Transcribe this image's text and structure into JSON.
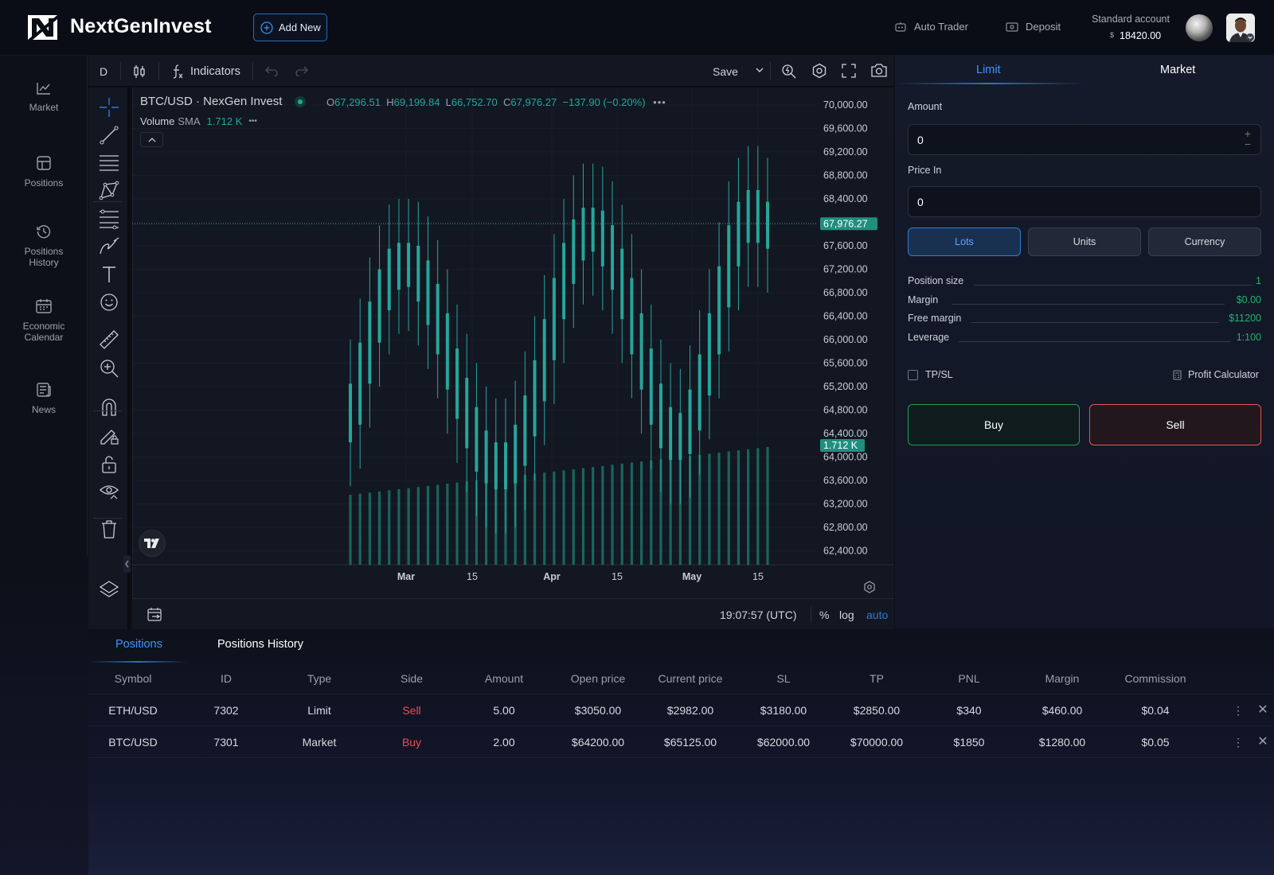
{
  "header": {
    "brand": "NextGenInvest",
    "add_new": "Add New",
    "auto_trader": "Auto Trader",
    "deposit": "Deposit",
    "account_label": "Standard account",
    "account_currency": "$",
    "account_balance": "18420.00"
  },
  "sidebar": {
    "items": [
      {
        "label": "Market",
        "icon": "chart-line-icon"
      },
      {
        "label": "Positions",
        "icon": "positions-icon"
      },
      {
        "label": "Positions History",
        "icon": "history-icon"
      },
      {
        "label": "Economic Calendar",
        "icon": "calendar-icon"
      },
      {
        "label": "News",
        "icon": "news-icon"
      }
    ]
  },
  "chart_toolbar": {
    "interval": "D",
    "indicators": "Indicators",
    "save": "Save"
  },
  "chart_header": {
    "symbol": "BTC/USD · NexGen Invest",
    "o_label": "O",
    "o": "67,296.51",
    "h_label": "H",
    "h": "69,199.84",
    "l_label": "L",
    "l": "66,752.70",
    "c_label": "C",
    "c": "67,976.27",
    "change": "−137.90 (−0.20%)",
    "volume_label": "Volume",
    "sma_label": "SMA",
    "volume_value": "1.712 K"
  },
  "chart_data": {
    "type": "candlestick",
    "symbol": "BTC/USD",
    "y_ticks": [
      "70,000.00",
      "69,600.00",
      "69,200.00",
      "68,800.00",
      "68,400.00",
      "68,000.00",
      "67,600.00",
      "67,200.00",
      "66,800.00",
      "66,400.00",
      "66,000.00",
      "65,600.00",
      "65,200.00",
      "64,800.00",
      "64,400.00",
      "64,000.00",
      "63,600.00",
      "63,200.00",
      "62,800.00",
      "62,400.00"
    ],
    "x_ticks": [
      "Mar",
      "15",
      "Apr",
      "15",
      "May",
      "15"
    ],
    "last_price": "67,976.27",
    "last_volume": "1.712 K",
    "ylim": [
      62200,
      70200
    ],
    "close_approx": [
      64900,
      65600,
      66300,
      66850,
      67200,
      67300,
      67250,
      67000,
      66600,
      66100,
      65500,
      65000,
      64500,
      64100,
      63900,
      63800,
      63900,
      64200,
      64700,
      65300,
      66000,
      66700,
      67300,
      67700,
      67900,
      67850,
      67600,
      67200,
      66700,
      66100,
      65500,
      64900,
      64500,
      64300,
      64400,
      64800,
      65400,
      66100,
      66900,
      67600,
      68000,
      68200,
      68000,
      67900
    ],
    "candle_color": "#26a69a",
    "volume_color": "#1b6e63"
  },
  "chart_status": {
    "time": "19:07:57 (UTC)",
    "percent": "%",
    "log": "log",
    "auto": "auto"
  },
  "order": {
    "tab_limit": "Limit",
    "tab_market": "Market",
    "amount_label": "Amount",
    "amount_value": "0",
    "price_label": "Price In",
    "price_value": "0",
    "seg_lots": "Lots",
    "seg_units": "Units",
    "seg_currency": "Currency",
    "stats": [
      {
        "label": "Position size",
        "value": "1"
      },
      {
        "label": "Margin",
        "value": "$0.00"
      },
      {
        "label": "Free margin",
        "value": "$11200"
      },
      {
        "label": "Leverage",
        "value": "1:100"
      }
    ],
    "tpsl": "TP/SL",
    "profit_calc": "Profit Calculator",
    "buy": "Buy",
    "sell": "Sell",
    "colors": {
      "buy_border": "#1f9d55",
      "sell_border": "#e15759",
      "accent": "#2f7bcf"
    }
  },
  "positions": {
    "tab_positions": "Positions",
    "tab_history": "Positions History",
    "columns": [
      "Symbol",
      "ID",
      "Type",
      "Side",
      "Amount",
      "Open price",
      "Current price",
      "SL",
      "TP",
      "PNL",
      "Margin",
      "Commission"
    ],
    "rows": [
      [
        "ETH/USD",
        "7302",
        "Limit",
        "Sell",
        "5.00",
        "$3050.00",
        "$2982.00",
        "$3180.00",
        "$2850.00",
        "$340",
        "$460.00",
        "$0.04"
      ],
      [
        "BTC/USD",
        "7301",
        "Market",
        "Buy",
        "2.00",
        "$64200.00",
        "$65125.00",
        "$62000.00",
        "$70000.00",
        "$1850",
        "$1280.00",
        "$0.05"
      ]
    ]
  }
}
